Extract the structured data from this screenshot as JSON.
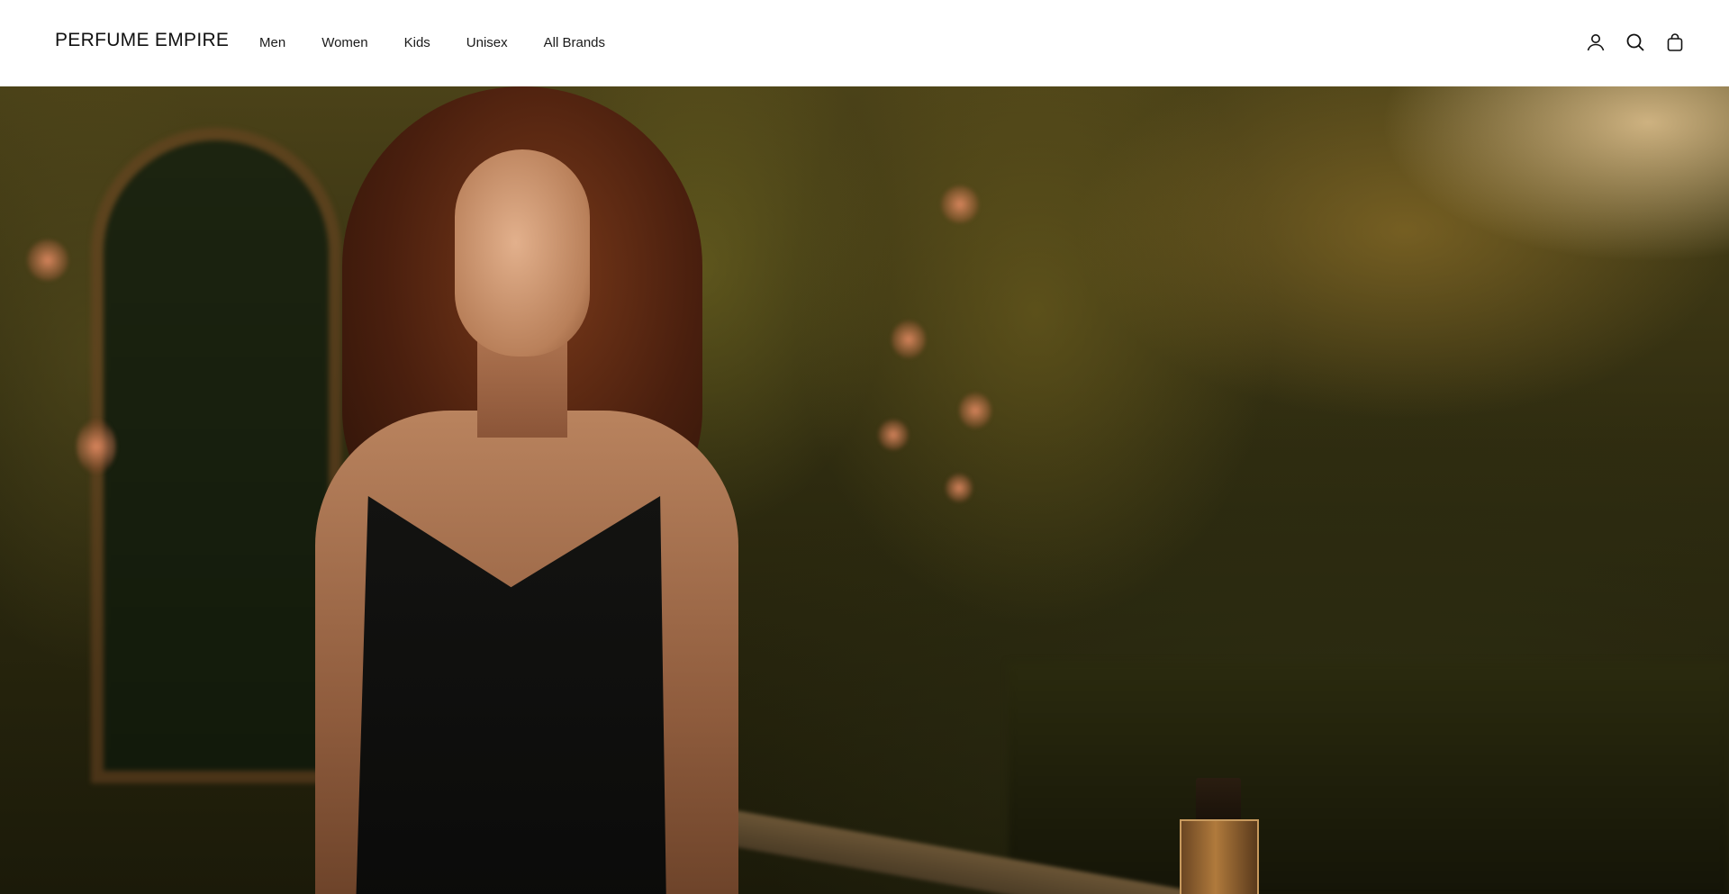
{
  "header": {
    "logo": "PERFUME EMPIRE",
    "nav": [
      {
        "label": "Men"
      },
      {
        "label": "Women"
      },
      {
        "label": "Kids"
      },
      {
        "label": "Unisex"
      },
      {
        "label": "All Brands"
      }
    ],
    "icons": [
      "account-icon",
      "search-icon",
      "cart-icon"
    ]
  },
  "hero": {
    "image_description": "woman in black dress in garden at sunset with perfume bottle"
  },
  "colors": {
    "header_bg": "#ffffff",
    "text": "#111111"
  }
}
